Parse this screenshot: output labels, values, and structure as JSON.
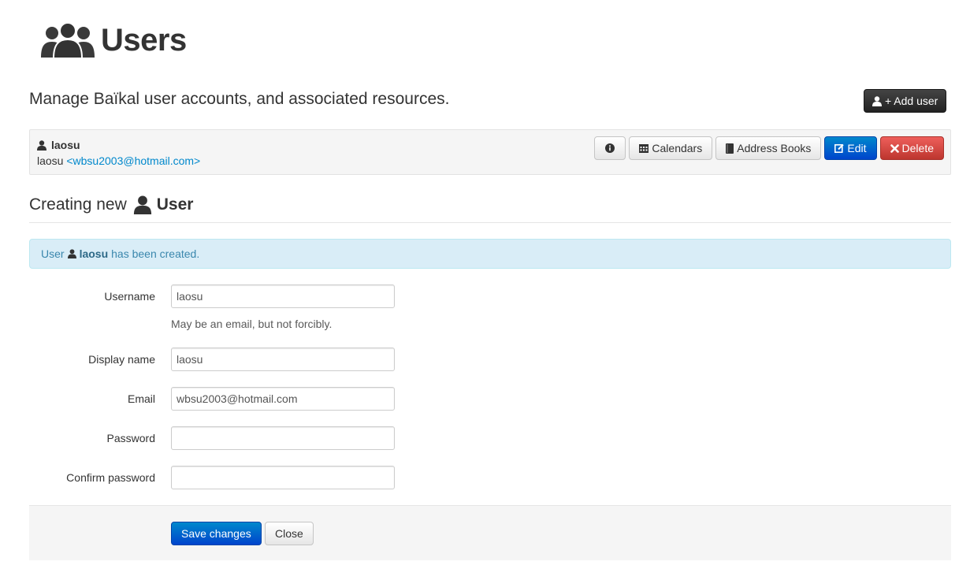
{
  "header": {
    "title": "Users"
  },
  "lead": "Manage Baïkal user accounts, and associated resources.",
  "add_user_label": "+ Add user",
  "user_row": {
    "username": "laosu",
    "display_name": "laosu",
    "email_display": "<wbsu2003@hotmail.com>",
    "buttons": {
      "calendars": "Calendars",
      "address_books": "Address Books",
      "edit": "Edit",
      "delete": "Delete"
    }
  },
  "section": {
    "prefix": "Creating new",
    "entity": "User"
  },
  "alert": {
    "before": "User",
    "username": "laosu",
    "after": "has been created."
  },
  "form": {
    "username": {
      "label": "Username",
      "value": "laosu",
      "help": "May be an email, but not forcibly."
    },
    "display_name": {
      "label": "Display name",
      "value": "laosu"
    },
    "email": {
      "label": "Email",
      "value": "wbsu2003@hotmail.com"
    },
    "password": {
      "label": "Password",
      "value": ""
    },
    "confirm_password": {
      "label": "Confirm password",
      "value": ""
    }
  },
  "actions": {
    "save": "Save changes",
    "close": "Close"
  },
  "colors": {
    "primary": "#0088cc",
    "danger": "#da4f49",
    "inverse": "#222222",
    "info_bg": "#d9edf7",
    "info_text": "#3a87ad"
  },
  "icons": [
    "users-icon",
    "user-icon",
    "info-icon",
    "calendar-icon",
    "book-icon",
    "edit-icon",
    "remove-icon"
  ]
}
